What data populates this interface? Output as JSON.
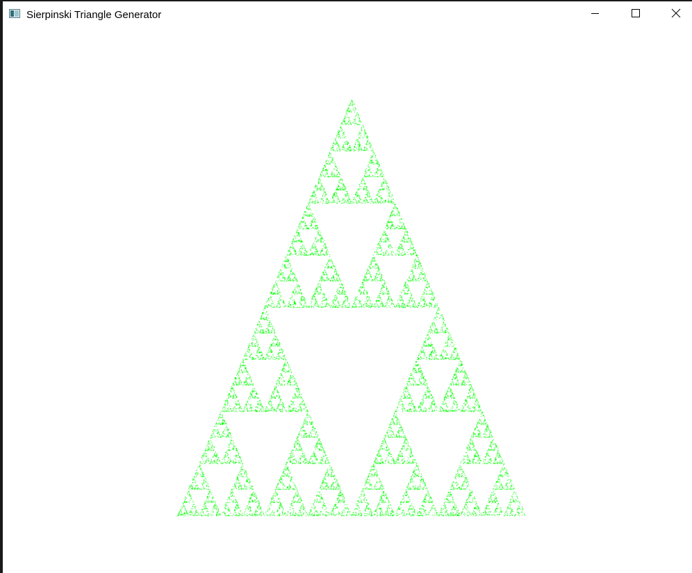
{
  "window": {
    "title": "Sierpinski Triangle Generator",
    "controls": {
      "minimize": "minimize-icon",
      "maximize": "maximize-icon",
      "close": "close-icon"
    }
  },
  "fractal": {
    "type": "Sierpinski triangle (chaos game point cloud)",
    "point_color": "#00ff00",
    "background_color": "#ffffff"
  },
  "colors": {
    "titlebar_bg": "#ffffff",
    "title_text": "#000000",
    "frame_border": "#1a1a1a"
  }
}
